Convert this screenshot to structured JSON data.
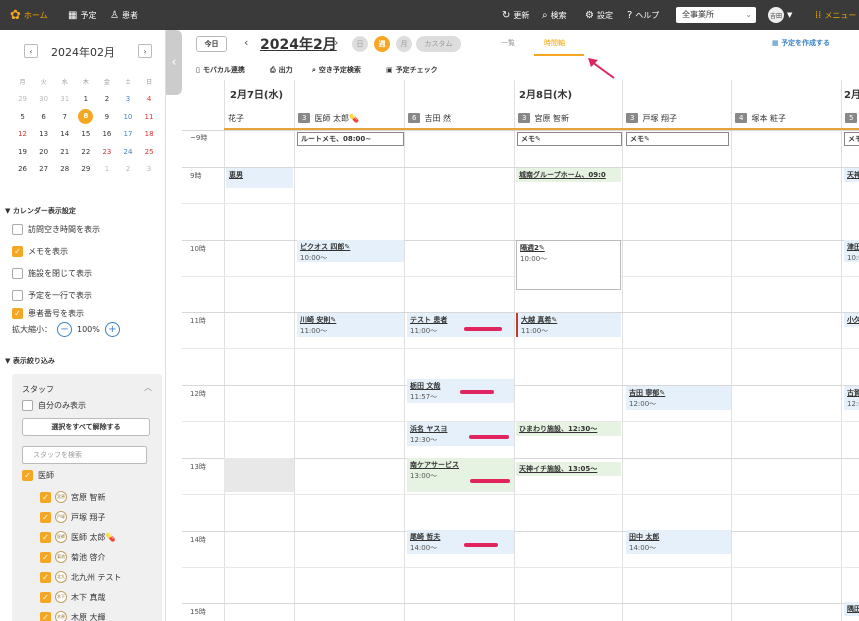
{
  "topbar": {
    "home": "ホーム",
    "schedule": "予定",
    "patients": "患者",
    "refresh": "更新",
    "search": "検索",
    "settings": "設定",
    "help": "ヘルプ",
    "office_select": "全事業所",
    "user_avatar": "吉田",
    "menu": "メニュー"
  },
  "sidebar": {
    "mini_month": "2024年02月",
    "weekdays": [
      "月",
      "火",
      "水",
      "木",
      "金",
      "土",
      "日"
    ],
    "weeks": [
      [
        "29",
        "30",
        "31",
        "1",
        "2",
        "3",
        "4"
      ],
      [
        "5",
        "6",
        "7",
        "8",
        "9",
        "10",
        "11"
      ],
      [
        "12",
        "13",
        "14",
        "15",
        "16",
        "17",
        "18"
      ],
      [
        "19",
        "20",
        "21",
        "22",
        "23",
        "24",
        "25"
      ],
      [
        "26",
        "27",
        "28",
        "29",
        "1",
        "2",
        "3"
      ]
    ],
    "calendar_settings_title": "▼ カレンダー表示設定",
    "options": [
      {
        "label": "訪問空き時間を表示",
        "checked": false
      },
      {
        "label": "メモを表示",
        "checked": true
      },
      {
        "label": "施設を閉じて表示",
        "checked": false
      },
      {
        "label": "予定を一行で表示",
        "checked": false
      },
      {
        "label": "患者番号を表示",
        "checked": true
      }
    ],
    "zoom_label": "拡大縮小：",
    "zoom_value": "100%",
    "filter_title": "▼ 表示絞り込み",
    "staff_title": "スタッフ",
    "self_only": "自分のみ表示",
    "clear_all": "選択をすべて解除する",
    "staff_search_placeholder": "スタッフを検索",
    "group": "医師",
    "staff": [
      {
        "avatar": "宮原",
        "name": "宮原 智新"
      },
      {
        "avatar": "戸塚",
        "name": "戸塚 翔子"
      },
      {
        "avatar": "医師",
        "name": "医師 太郎💊"
      },
      {
        "avatar": "菊池",
        "name": "菊池 啓介"
      },
      {
        "avatar": "北九",
        "name": "北九州 テスト"
      },
      {
        "avatar": "木下",
        "name": "木下 真哉"
      },
      {
        "avatar": "木原",
        "name": "木原 大輝"
      }
    ]
  },
  "toolbar": {
    "today": "今日",
    "current_range": "2024年2月",
    "views": [
      "日",
      "週",
      "月"
    ],
    "custom": "カスタム",
    "tab_list": "一覧",
    "tab_timeline": "時間軸",
    "create": "予定を作成する",
    "mobacal": "モバカル連携",
    "print": "出力",
    "search_free": "空き予定検索",
    "check": "予定チェック"
  },
  "grid": {
    "day1": "2月7日(水)",
    "day2": "2月8日(木)",
    "day3": "2月",
    "staff_cols": [
      {
        "num": "",
        "name": "花子"
      },
      {
        "num": "3",
        "name": "医師 太郎💊"
      },
      {
        "num": "6",
        "name": "吉田 然"
      },
      {
        "num": "3",
        "name": "宮原 智新"
      },
      {
        "num": "3",
        "name": "戸塚 翔子"
      },
      {
        "num": "4",
        "name": "塚本 粧子"
      },
      {
        "num": "5",
        "name": ""
      }
    ],
    "times": [
      "~9時",
      "9時",
      "10時",
      "11時",
      "12時",
      "13時",
      "14時",
      "15時"
    ],
    "memos": [
      "ルートメモ、08:00~",
      "メモ✎",
      "メモ✎",
      "メモ"
    ],
    "events": [
      {
        "title": "恵男",
        "sub": ""
      },
      {
        "title": "城南グループホーム、09:0",
        "sub": ""
      },
      {
        "title": "天神",
        "sub": ""
      },
      {
        "title": "ピクオス 四郎✎",
        "sub": "10:00〜"
      },
      {
        "title": "隔週2✎",
        "sub": "10:00〜"
      },
      {
        "title": "津田",
        "sub": "10:0"
      },
      {
        "title": "川崎 安則✎",
        "sub": "11:00〜"
      },
      {
        "title": "テスト 患者",
        "sub": "11:00〜"
      },
      {
        "title": "大越 真希✎",
        "sub": "11:00〜"
      },
      {
        "title": "小久",
        "sub": ""
      },
      {
        "title": "栃田 文哉",
        "sub": "11:57〜"
      },
      {
        "title": "吉田 寧郁✎",
        "sub": "12:00〜"
      },
      {
        "title": "古賀",
        "sub": "12:0"
      },
      {
        "title": "浜名 ヤスヨ",
        "sub": "12:30〜"
      },
      {
        "title": "ひまわり施設、12:30〜",
        "sub": ""
      },
      {
        "title": "南ケアサービス",
        "sub": "13:00〜"
      },
      {
        "title": "天神イチ施設、13:05〜",
        "sub": ""
      },
      {
        "title": "尾崎 哲夫",
        "sub": "14:00〜"
      },
      {
        "title": "田中 太郎",
        "sub": "14:00〜"
      },
      {
        "title": "隅田",
        "sub": ""
      }
    ]
  }
}
